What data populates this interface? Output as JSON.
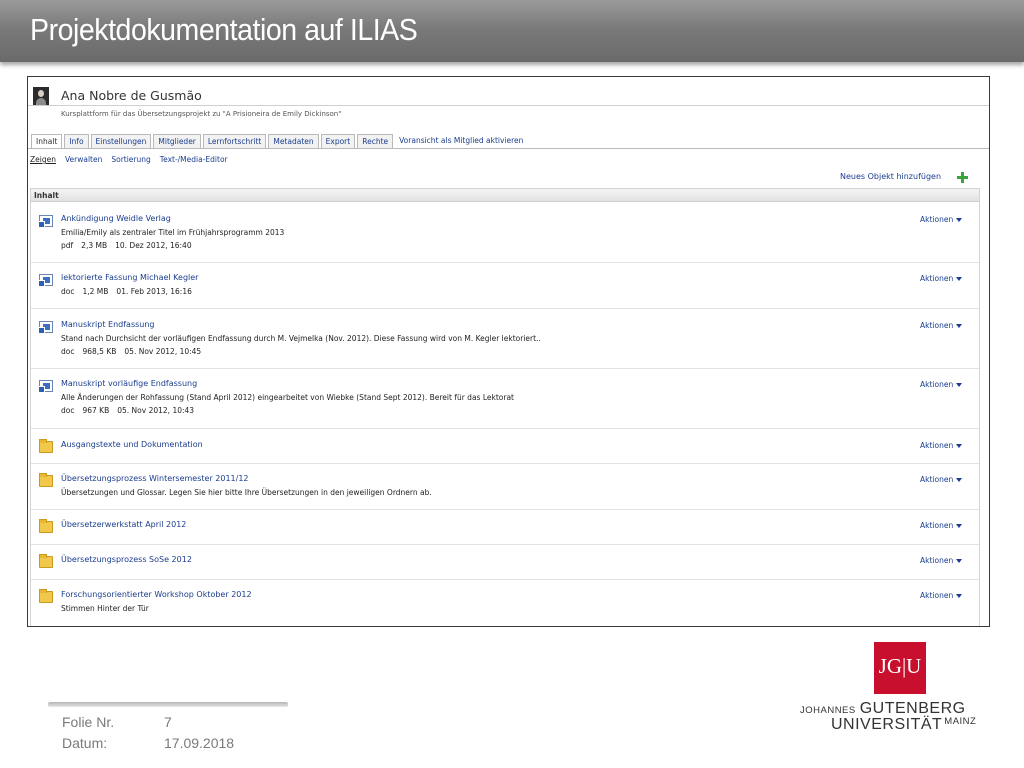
{
  "slide": {
    "title": "Projektdokumentation auf ILIAS"
  },
  "user": {
    "name": "Ana Nobre de Gusmão",
    "subtitle": "Kursplattform für das Übersetzungsprojekt zu \"A Prisioneira de Emily Dickinson\""
  },
  "tabs": [
    {
      "label": "Inhalt",
      "active": true
    },
    {
      "label": "Info"
    },
    {
      "label": "Einstellungen"
    },
    {
      "label": "Mitglieder"
    },
    {
      "label": "Lernfortschritt"
    },
    {
      "label": "Metadaten"
    },
    {
      "label": "Export"
    },
    {
      "label": "Rechte"
    },
    {
      "label": "Voransicht als Mitglied aktivieren"
    }
  ],
  "subtabs": [
    {
      "label": "Zeigen",
      "active": true
    },
    {
      "label": "Verwalten"
    },
    {
      "label": "Sortierung"
    },
    {
      "label": "Text-/Media-Editor"
    }
  ],
  "add_object_label": "Neues Objekt hinzufügen",
  "content_header": "Inhalt",
  "actions_label": "Aktionen",
  "items": [
    {
      "type": "file",
      "title": "Ankündigung Weidle Verlag",
      "description": "Emilia/Emily als zentraler Titel im Frühjahrsprogramm 2013",
      "props": [
        "pdf",
        "2,3 MB",
        "10. Dez 2012, 16:40"
      ]
    },
    {
      "type": "file",
      "title": "lektorierte Fassung Michael Kegler",
      "description": "",
      "props": [
        "doc",
        "1,2 MB",
        "01. Feb 2013, 16:16"
      ]
    },
    {
      "type": "file",
      "title": "Manuskript Endfassung",
      "description": "Stand nach Durchsicht der vorläufigen Endfassung durch M. Vejmelka (Nov. 2012). Diese Fassung wird von M. Kegler lektoriert..",
      "props": [
        "doc",
        "968,5 KB",
        "05. Nov 2012, 10:45"
      ]
    },
    {
      "type": "file",
      "title": "Manuskript vorläufige Endfassung",
      "description": "Alle Änderungen der Rohfassung (Stand April 2012) eingearbeitet von Wiebke (Stand Sept 2012). Bereit für das Lektorat",
      "props": [
        "doc",
        "967 KB",
        "05. Nov 2012, 10:43"
      ]
    },
    {
      "type": "folder",
      "title": "Ausgangstexte und Dokumentation",
      "description": "",
      "props": []
    },
    {
      "type": "folder",
      "title": "Übersetzungsprozess Wintersemester 2011/12",
      "description": "Übersetzungen und Glossar. Legen Sie hier bitte Ihre Übersetzungen in den jeweiligen Ordnern ab.",
      "props": []
    },
    {
      "type": "folder",
      "title": "Übersetzerwerkstatt April 2012",
      "description": "",
      "props": []
    },
    {
      "type": "folder",
      "title": "Übersetzungsprozess SoSe 2012",
      "description": "",
      "props": []
    },
    {
      "type": "folder",
      "title": "Forschungsorientierter Workshop Oktober 2012",
      "description": "Stimmen Hinter der Tür",
      "props": []
    }
  ],
  "footer": {
    "slide_label": "Folie Nr.",
    "slide_value": "7",
    "date_label": "Datum:",
    "date_value": "17.09.2018"
  },
  "logo": {
    "mark": "JG|U",
    "line1_small": "JOHANNES",
    "line1_big": "GUTENBERG",
    "line2_big": "UNIVERSITÄT",
    "line2_small": "MAINZ"
  },
  "colors": {
    "link": "#1a3d8f",
    "logo_red": "#c8102e",
    "header_gray": "#7a7a7a"
  }
}
